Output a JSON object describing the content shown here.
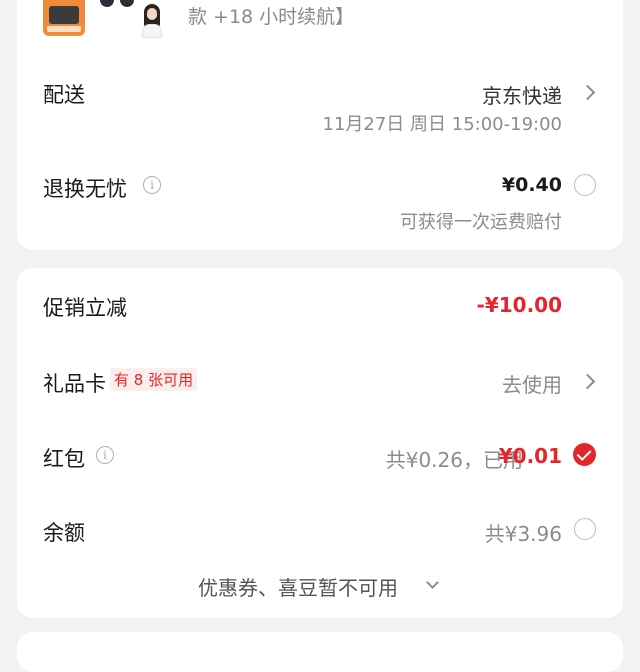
{
  "product": {
    "snippet": "款 +18 小时续航】"
  },
  "delivery": {
    "label": "配送",
    "carrier": "京东快递",
    "time": "11月27日 周日 15:00-19:00"
  },
  "return_insurance": {
    "label": "退换无忧",
    "price": "¥0.40",
    "desc": "可获得一次运费赔付"
  },
  "promotion": {
    "label": "促销立减",
    "amount": "-¥10.00"
  },
  "gift_card": {
    "label": "礼品卡",
    "badge": "有 8 张可用",
    "action": "去使用"
  },
  "red_packet": {
    "label": "红包",
    "total": "共¥0.26，已用",
    "used": "¥0.01"
  },
  "balance": {
    "label": "余额",
    "total": "共¥3.96"
  },
  "coupons": {
    "text": "优惠券、喜豆暂不可用"
  },
  "colors": {
    "accent_red": "#e4262b",
    "background": "#f2f2f2"
  }
}
